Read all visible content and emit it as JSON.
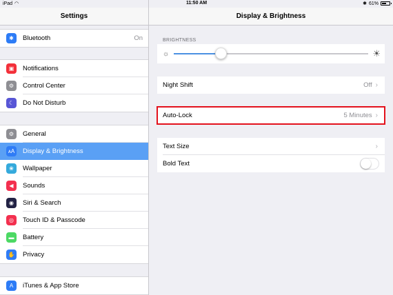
{
  "status_bar": {
    "device": "iPad",
    "time": "11:50 AM",
    "battery": "61%",
    "battery_level": 0.61
  },
  "left": {
    "title": "Settings",
    "group1": [
      {
        "label": "Bluetooth",
        "value": "On",
        "icon": "bluetooth-icon",
        "color": "#2d7cf6"
      }
    ],
    "group2": [
      {
        "label": "Notifications",
        "icon": "notifications-icon",
        "color": "#f3303a"
      },
      {
        "label": "Control Center",
        "icon": "control-center-icon",
        "color": "#8e8e93"
      },
      {
        "label": "Do Not Disturb",
        "icon": "moon-icon",
        "color": "#5856d6"
      }
    ],
    "group3": [
      {
        "label": "General",
        "icon": "gear-icon",
        "color": "#8e8e93"
      },
      {
        "label": "Display & Brightness",
        "icon": "display-icon",
        "color": "#2f7cf6",
        "selected": true
      },
      {
        "label": "Wallpaper",
        "icon": "wallpaper-icon",
        "color": "#35aadc"
      },
      {
        "label": "Sounds",
        "icon": "sounds-icon",
        "color": "#f3304f"
      },
      {
        "label": "Siri & Search",
        "icon": "siri-icon",
        "color": "#222244"
      },
      {
        "label": "Touch ID & Passcode",
        "icon": "fingerprint-icon",
        "color": "#f3304f"
      },
      {
        "label": "Battery",
        "icon": "battery-icon",
        "color": "#4cd964"
      },
      {
        "label": "Privacy",
        "icon": "hand-icon",
        "color": "#2f7cf6"
      }
    ],
    "group4": [
      {
        "label": "iTunes & App Store",
        "icon": "app-store-icon",
        "color": "#2d7cf6"
      }
    ]
  },
  "right": {
    "title": "Display & Brightness",
    "brightness_label": "BRIGHTNESS",
    "brightness_level": 0.24,
    "night_shift": {
      "label": "Night Shift",
      "value": "Off"
    },
    "auto_lock": {
      "label": "Auto-Lock",
      "value": "5 Minutes"
    },
    "text_size": {
      "label": "Text Size"
    },
    "bold_text": {
      "label": "Bold Text",
      "enabled": false
    }
  },
  "colors": {
    "accent": "#5aa0f5",
    "highlight": "#e3101b",
    "slider_fill": "#4a90e2"
  }
}
